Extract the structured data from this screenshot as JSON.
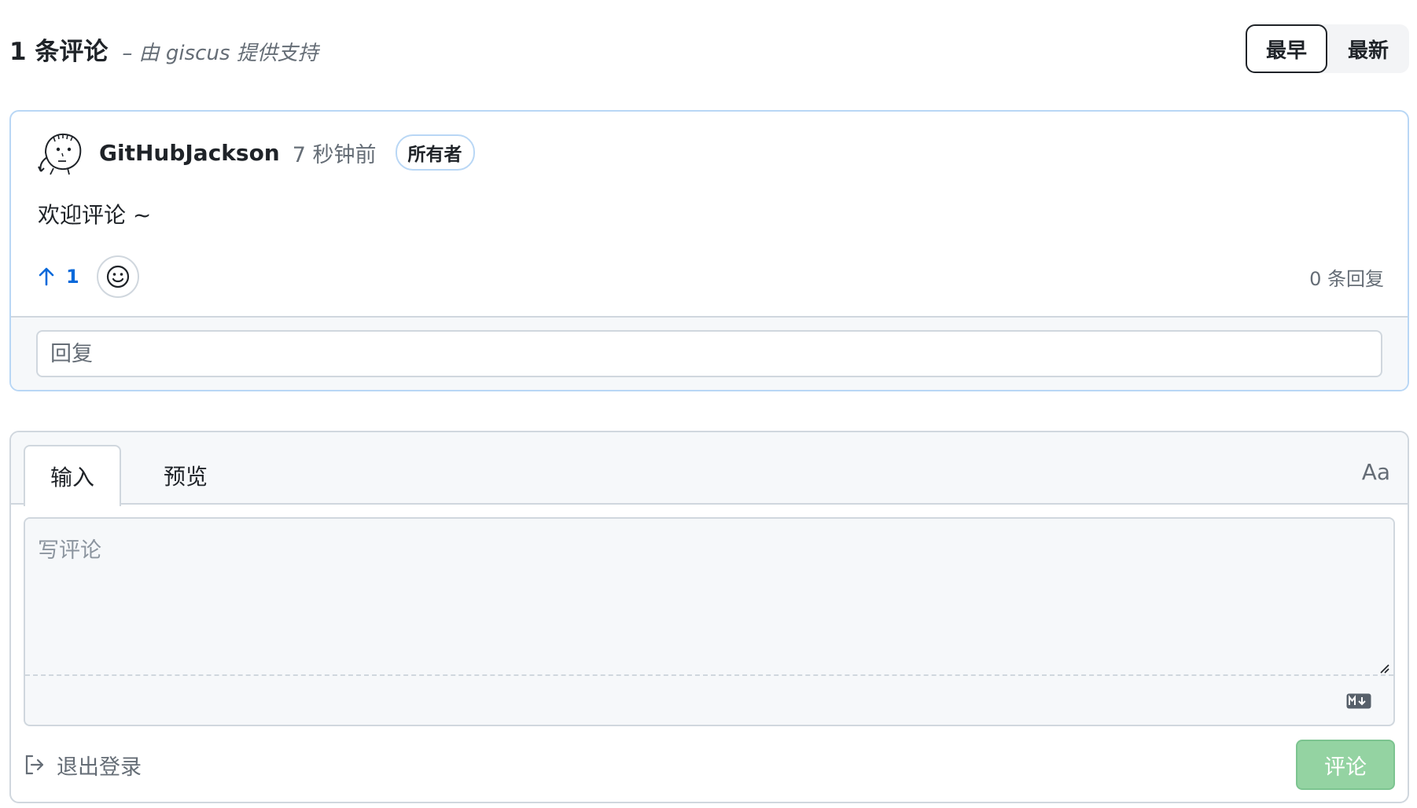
{
  "header": {
    "comment_count": "1 条评论",
    "powered_by": "– 由 giscus 提供支持",
    "sort_oldest": "最早",
    "sort_newest": "最新"
  },
  "comment": {
    "author": "GitHubJackson",
    "time": "7 秒钟前",
    "badge": "所有者",
    "body": "欢迎评论 ~",
    "upvotes": "1",
    "reply_count": "0 条回复",
    "reply_placeholder": "回复"
  },
  "editor": {
    "tab_write": "输入",
    "tab_preview": "预览",
    "format_label": "Aa",
    "placeholder": "写评论",
    "logout_label": "退出登录",
    "submit_label": "评论"
  },
  "colors": {
    "accent_blue": "#0969da",
    "card_border": "#b9d7f5",
    "submit_disabled": "#94d3a2"
  },
  "icons": {
    "avatar": "hand-drawn-face-avatar",
    "upvote": "arrow-up-icon",
    "reaction": "smiley-icon",
    "markdown": "markdown-icon",
    "logout": "sign-out-icon"
  }
}
